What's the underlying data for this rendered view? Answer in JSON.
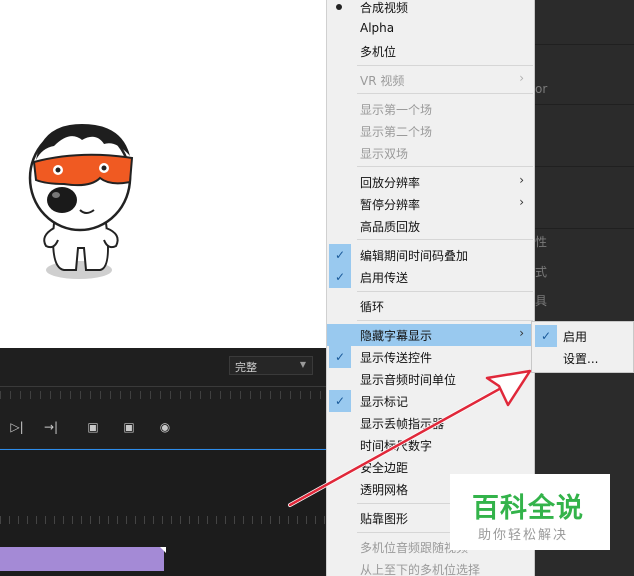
{
  "monitor": {
    "quality_dropdown": "完整"
  },
  "right_panel": {
    "texts": [
      "or",
      "性",
      "式",
      "具"
    ]
  },
  "context_menu": {
    "items": [
      {
        "label": "合成视频",
        "state": "radio",
        "disabled": false
      },
      {
        "label": "Alpha",
        "disabled": false
      },
      {
        "label": "多机位",
        "disabled": false
      },
      {
        "label": "VR 视频",
        "disabled": true,
        "submenu": true
      },
      {
        "label": "显示第一个场",
        "disabled": true
      },
      {
        "label": "显示第二个场",
        "disabled": true
      },
      {
        "label": "显示双场",
        "disabled": true
      },
      {
        "label": "回放分辨率",
        "disabled": false,
        "submenu": true
      },
      {
        "label": "暂停分辨率",
        "disabled": false,
        "submenu": true
      },
      {
        "label": "高品质回放",
        "disabled": false
      },
      {
        "label": "编辑期间时间码叠加",
        "checked": true
      },
      {
        "label": "启用传送",
        "checked": true
      },
      {
        "label": "循环",
        "disabled": false
      },
      {
        "label": "隐藏字幕显示",
        "highlighted": true,
        "submenu": true
      },
      {
        "label": "显示传送控件",
        "checked": true
      },
      {
        "label": "显示音频时间单位",
        "disabled": false
      },
      {
        "label": "显示标记",
        "checked": true
      },
      {
        "label": "显示丢帧指示器",
        "disabled": false
      },
      {
        "label": "时间标尺数字",
        "disabled": false
      },
      {
        "label": "安全边距",
        "disabled": false
      },
      {
        "label": "透明网格",
        "disabled": false
      },
      {
        "label": "贴靠图形",
        "disabled": false
      },
      {
        "label": "多机位音频跟随视频",
        "disabled": true
      },
      {
        "label": "从上至下的多机位选择",
        "disabled": true
      }
    ]
  },
  "submenu": {
    "items": [
      {
        "label": "启用",
        "checked": true
      },
      {
        "label": "设置..."
      }
    ]
  },
  "watermark": {
    "title": "百科全说",
    "subtitle": "助你轻松解决"
  },
  "colors": {
    "highlight": "#99c9ef",
    "annotation_arrow": "#e0283a",
    "watermark_green": "#33b34a",
    "clip_purple": "#a48ad6"
  }
}
